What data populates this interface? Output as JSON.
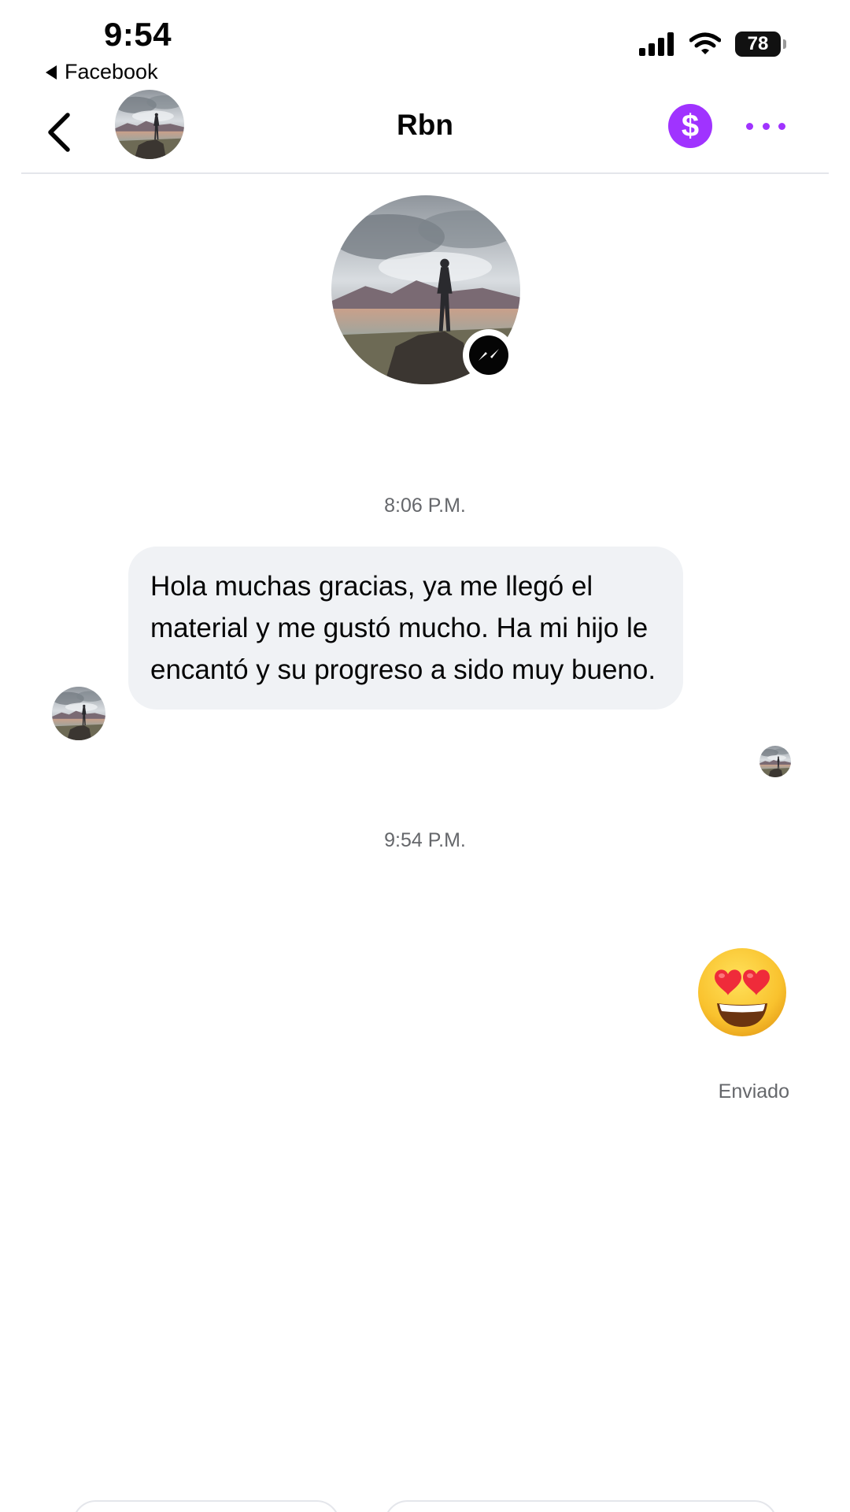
{
  "status_bar": {
    "time": "9:54",
    "back_app": "Facebook",
    "battery": "78"
  },
  "header": {
    "title": "Rbn",
    "pay_symbol": "$"
  },
  "conversation": {
    "timestamp_1": "8:06 P.M.",
    "message_1": "Hola muchas gracias, ya me llegó el material y me gustó mucho. Ha mi hijo le encantó y su progreso a sido muy bueno.",
    "timestamp_2": "9:54 P.M.",
    "emoji_message": "heart-eyes-emoji",
    "sent_status": "Enviado"
  },
  "colors": {
    "accent": "#a033ff",
    "bubble_bg": "#f0f2f5",
    "muted_text": "#65676b"
  }
}
